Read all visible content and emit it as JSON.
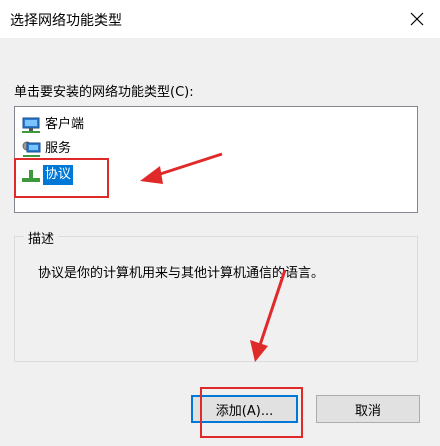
{
  "window": {
    "title": "选择网络功能类型"
  },
  "instruction": "单击要安装的网络功能类型(C):",
  "list": {
    "items": [
      {
        "label": "客户端",
        "icon": "network-client-icon",
        "selected": false
      },
      {
        "label": "服务",
        "icon": "network-service-icon",
        "selected": false
      },
      {
        "label": "协议",
        "icon": "network-protocol-icon",
        "selected": true
      }
    ]
  },
  "description_group": {
    "title": "描述",
    "text": "协议是你的计算机用来与其他计算机通信的语言。"
  },
  "buttons": {
    "add": "添加(A)...",
    "cancel": "取消"
  },
  "colors": {
    "selection": "#0078d7",
    "annotation": "#e02a2a",
    "default_button_border": "#0078d7"
  }
}
